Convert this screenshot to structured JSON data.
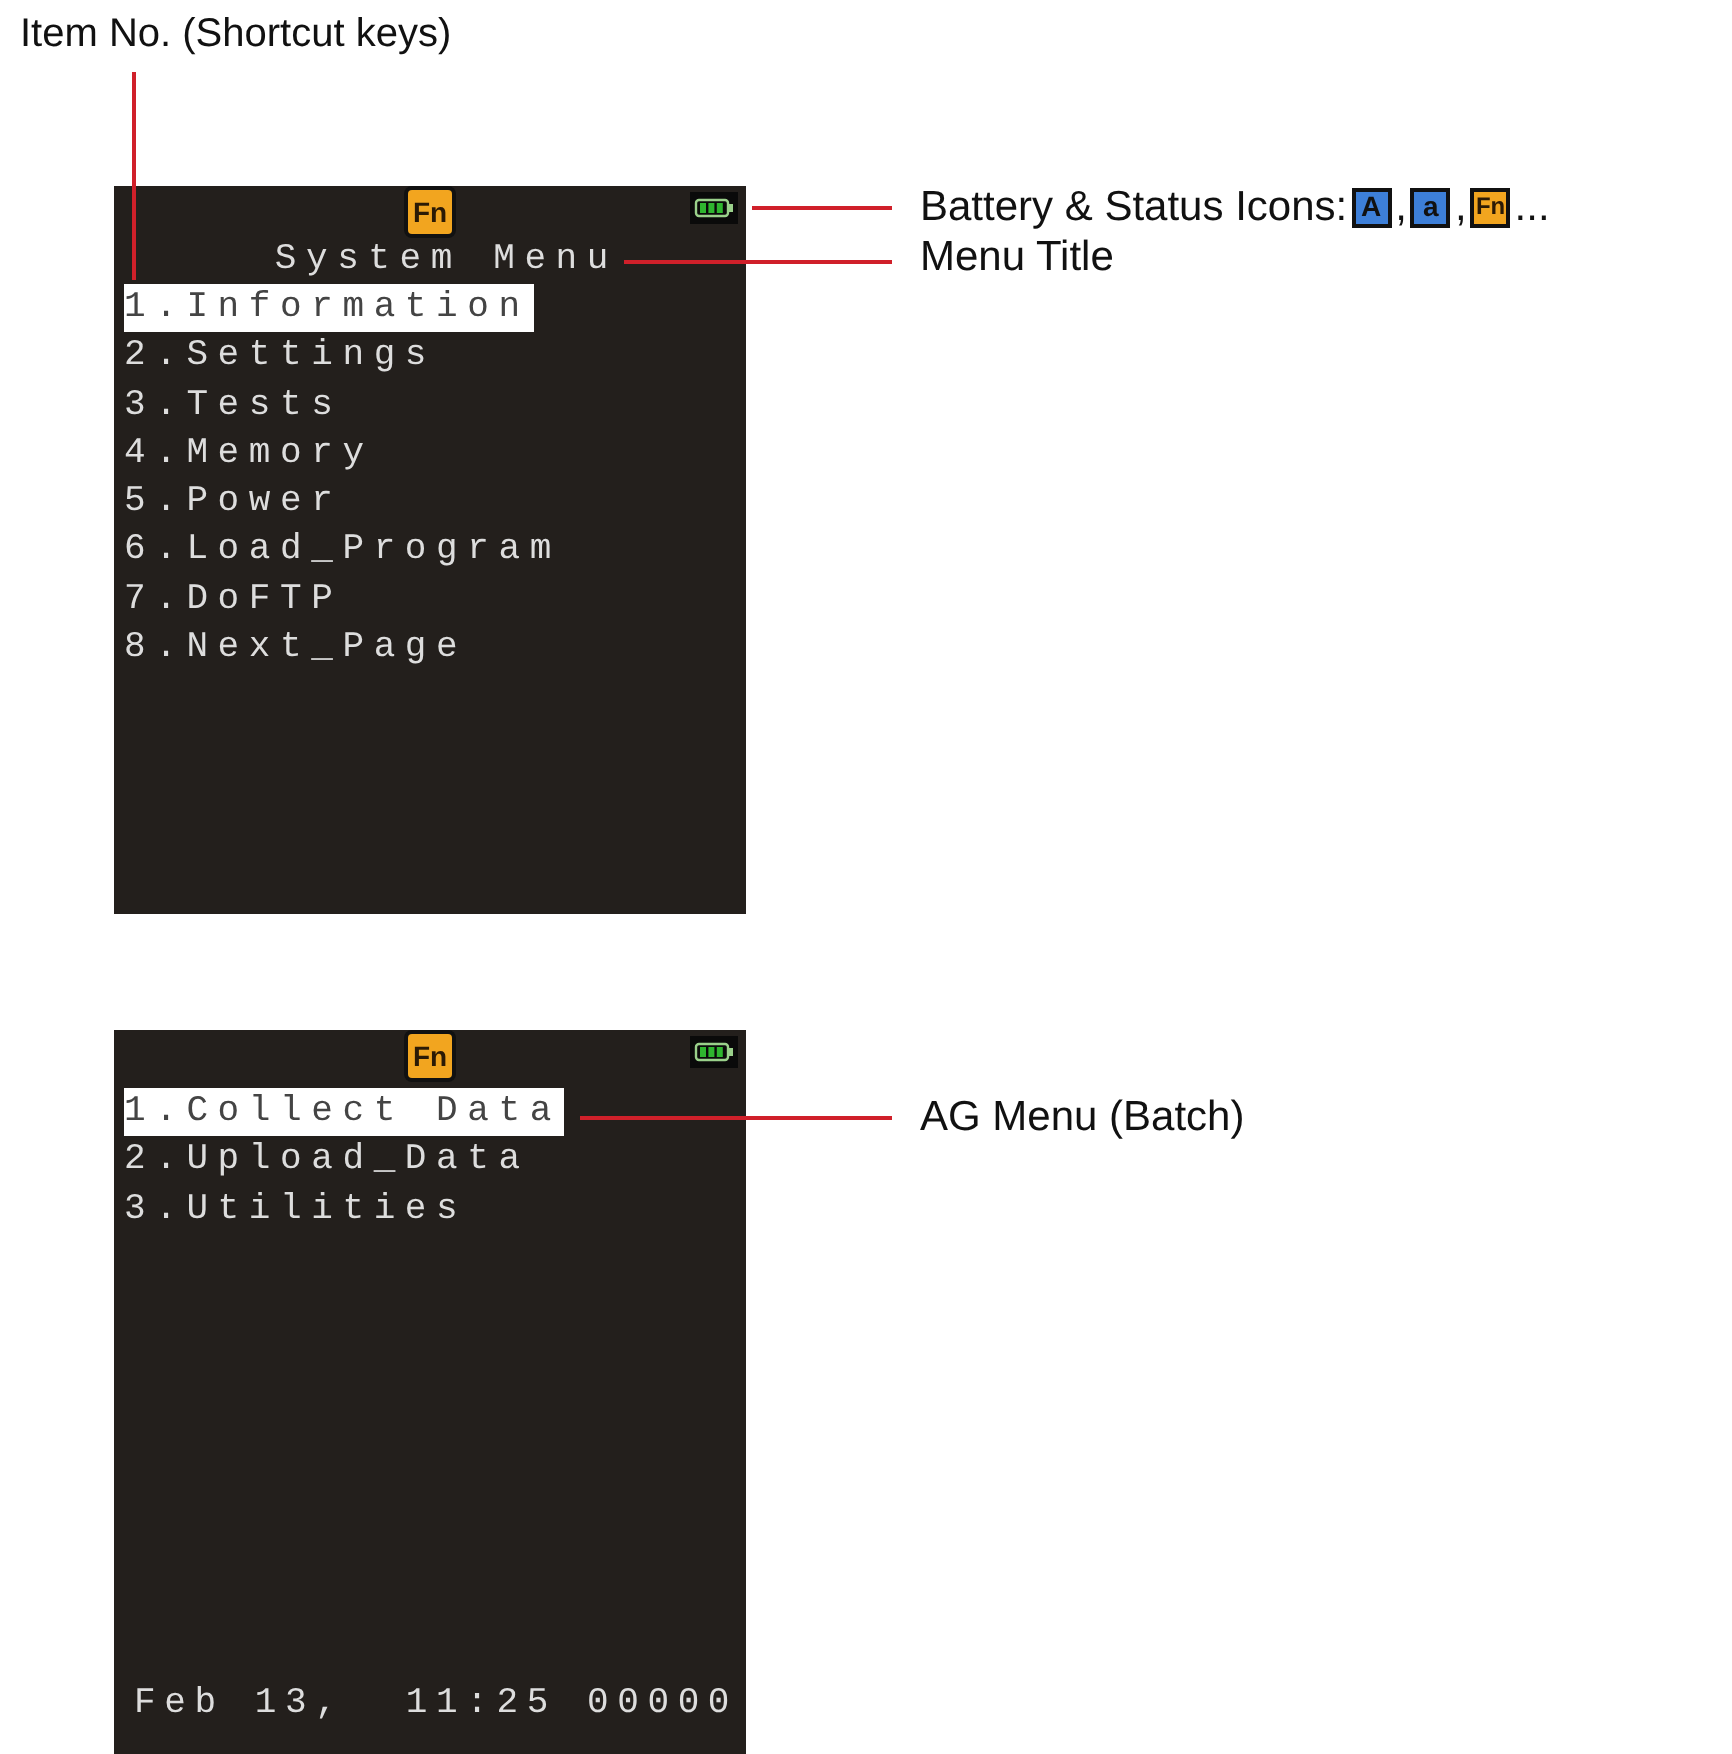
{
  "item_no_label": "Item No. (Shortcut keys)",
  "screens": [
    {
      "status_icon": "Fn",
      "title": "System Menu",
      "items": [
        {
          "label": "1.Information",
          "selected": true
        },
        {
          "label": "2.Settings",
          "selected": false
        },
        {
          "label": "3.Tests",
          "selected": false
        },
        {
          "label": "4.Memory",
          "selected": false
        },
        {
          "label": "5.Power",
          "selected": false
        },
        {
          "label": "6.Load_Program",
          "selected": false
        },
        {
          "label": "7.DoFTP",
          "selected": false
        },
        {
          "label": "8.Next_Page",
          "selected": false
        }
      ],
      "callouts": [
        {
          "kind": "status",
          "text": "Battery & Status Icons:",
          "icons": [
            {
              "kind": "blue",
              "label": "A"
            },
            {
              "kind": "blue",
              "label": "a"
            },
            {
              "kind": "orange",
              "label": "Fn"
            }
          ],
          "separator": ",",
          "ellipsis": "..."
        },
        {
          "kind": "plain",
          "text": "Menu Title"
        }
      ]
    },
    {
      "status_icon": "Fn",
      "items": [
        {
          "label": "1.Collect Data",
          "selected": true
        },
        {
          "label": "2.Upload_Data",
          "selected": false
        },
        {
          "label": "3.Utilities",
          "selected": false
        }
      ],
      "footer": "Feb 13,  11:25 00000",
      "callouts": [
        {
          "kind": "plain",
          "text": "AG Menu (Batch)"
        }
      ]
    }
  ]
}
